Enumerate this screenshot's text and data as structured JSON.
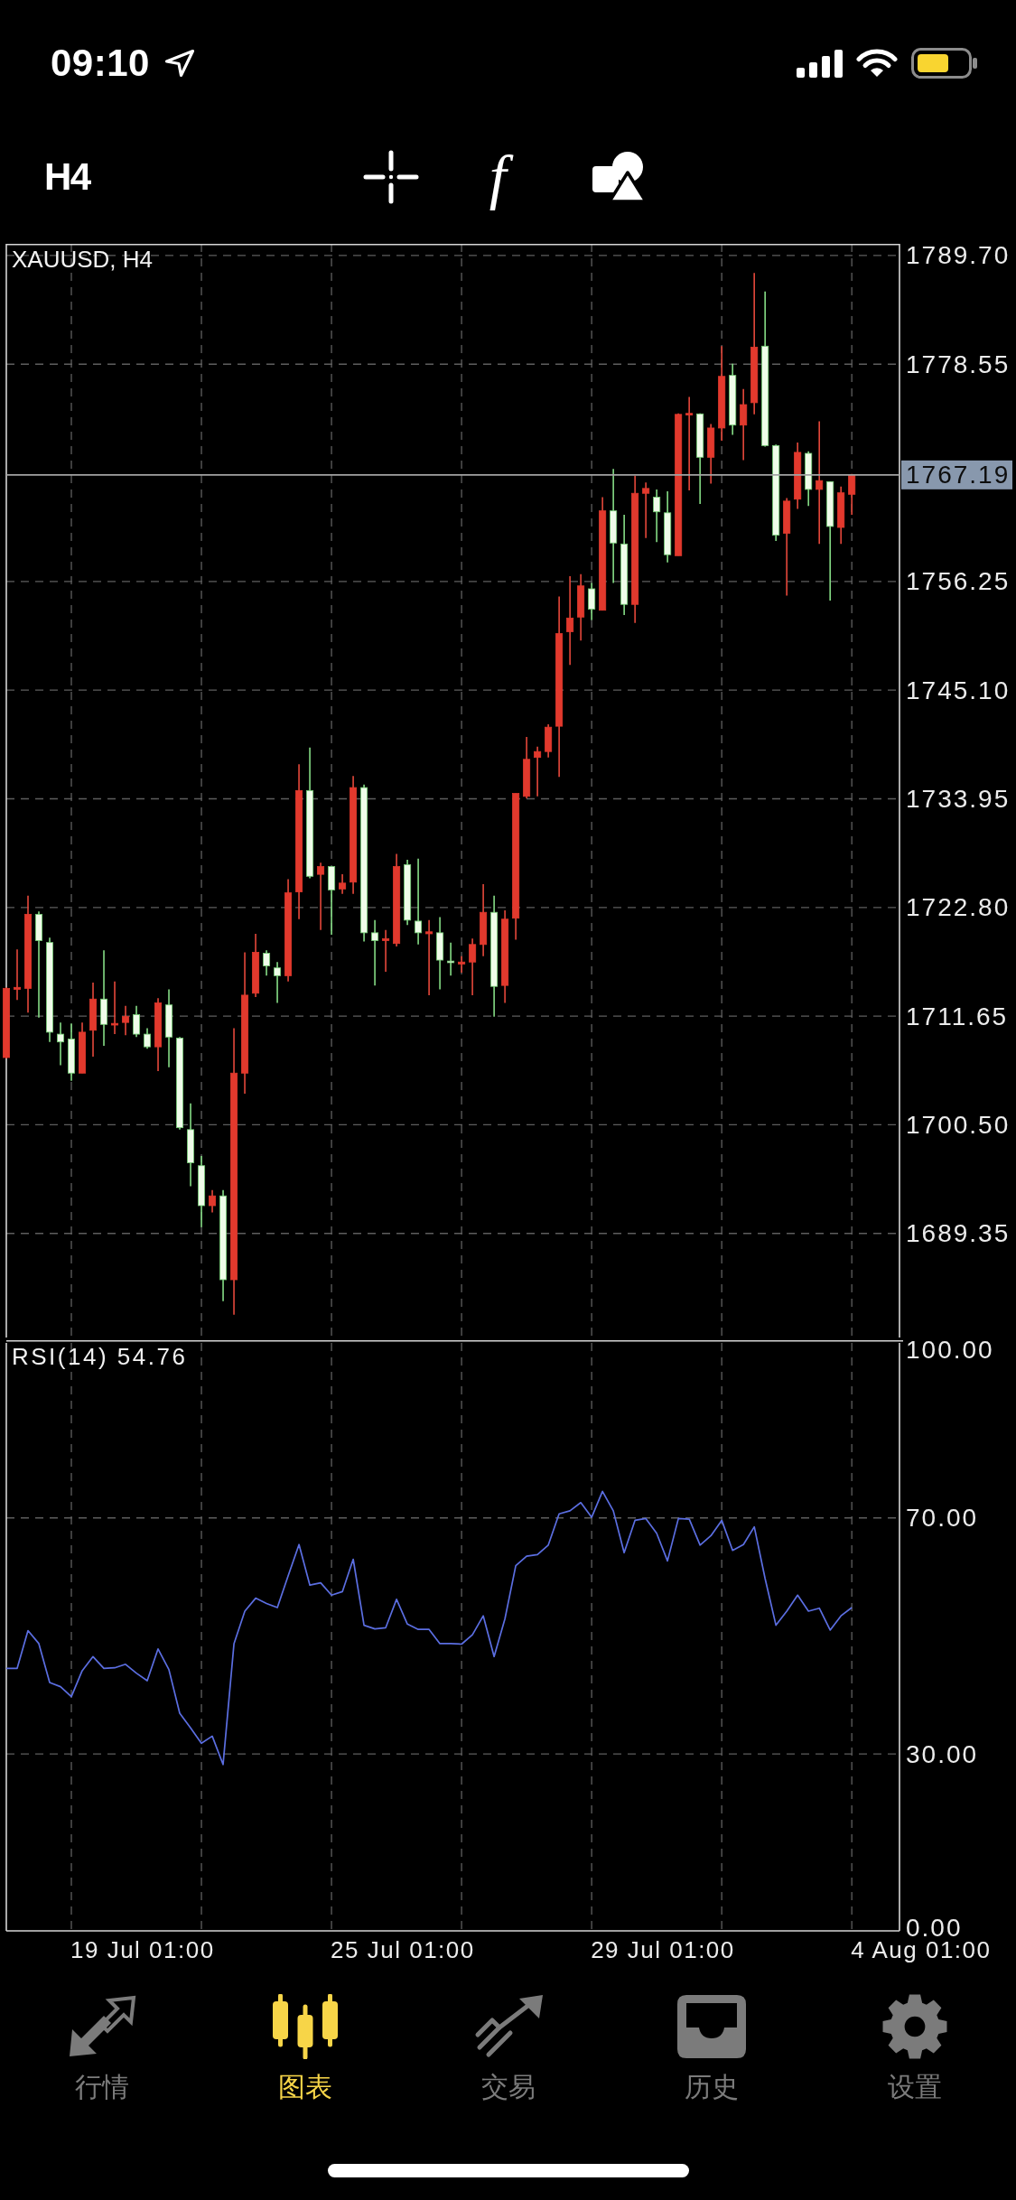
{
  "status_bar": {
    "time": "09:10"
  },
  "toolbar": {
    "timeframe": "H4",
    "tools": [
      {
        "kind": "crosshair"
      },
      {
        "kind": "function",
        "label": "f"
      },
      {
        "kind": "objects"
      }
    ]
  },
  "price_chart": {
    "chart_data": {
      "type": "candlestick",
      "title": "XAUUSD, H4",
      "categories": [
        null,
        null,
        null,
        null,
        null,
        null,
        null,
        null,
        null,
        null,
        null,
        null,
        null,
        null,
        null,
        null,
        null,
        null,
        null,
        null,
        null,
        null,
        null,
        null,
        null,
        null,
        null,
        null,
        null,
        null,
        null,
        null,
        null,
        null,
        null,
        null,
        null,
        null,
        null,
        null,
        null,
        null,
        null,
        null,
        null,
        null,
        null,
        null,
        null,
        null,
        null,
        null,
        null,
        null,
        null,
        null,
        null,
        null,
        null,
        null,
        null,
        null,
        null,
        null,
        null,
        null,
        null,
        null,
        null,
        null,
        null,
        null,
        null,
        null,
        null,
        null,
        null,
        null,
        null
      ],
      "ohlc": [
        [
          1707.4,
          1714.6,
          1707.3,
          1714.5
        ],
        [
          1714.4,
          1718.5,
          1713.3,
          1714.6
        ],
        [
          1714.5,
          1724.0,
          1712.0,
          1722.1
        ],
        [
          1722.1,
          1722.4,
          1711.5,
          1719.4
        ],
        [
          1719.2,
          1719.7,
          1709.0,
          1710.0
        ],
        [
          1709.8,
          1711.0,
          1706.6,
          1709.0
        ],
        [
          1709.3,
          1710.9,
          1705.0,
          1705.8
        ],
        [
          1705.8,
          1711.0,
          1705.8,
          1710.0
        ],
        [
          1710.2,
          1715.1,
          1707.5,
          1713.4
        ],
        [
          1713.4,
          1718.4,
          1708.6,
          1710.8
        ],
        [
          1710.8,
          1715.2,
          1709.8,
          1710.9
        ],
        [
          1711.0,
          1712.7,
          1709.7,
          1711.6
        ],
        [
          1711.8,
          1712.7,
          1709.5,
          1709.8
        ],
        [
          1709.8,
          1710.4,
          1708.3,
          1708.5
        ],
        [
          1708.5,
          1713.5,
          1706.0,
          1713.0
        ],
        [
          1712.8,
          1714.4,
          1706.4,
          1709.5
        ],
        [
          1709.4,
          1709.5,
          1700.0,
          1700.2
        ],
        [
          1700.0,
          1702.7,
          1694.2,
          1696.6
        ],
        [
          1696.3,
          1697.3,
          1690.0,
          1692.2
        ],
        [
          1692.2,
          1693.8,
          1691.5,
          1693.2
        ],
        [
          1693.2,
          1693.8,
          1682.4,
          1684.6
        ],
        [
          1684.6,
          1710.4,
          1681.0,
          1705.8
        ],
        [
          1705.8,
          1718.2,
          1703.7,
          1713.8
        ],
        [
          1714.0,
          1720.1,
          1713.6,
          1718.2
        ],
        [
          1718.1,
          1718.4,
          1715.8,
          1716.8
        ],
        [
          1716.6,
          1717.2,
          1713.0,
          1715.8
        ],
        [
          1715.8,
          1725.7,
          1715.2,
          1724.3
        ],
        [
          1724.4,
          1737.5,
          1721.6,
          1734.8
        ],
        [
          1734.8,
          1739.2,
          1725.8,
          1726.0
        ],
        [
          1726.2,
          1727.4,
          1720.5,
          1727.0
        ],
        [
          1727.0,
          1727.0,
          1720.0,
          1724.6
        ],
        [
          1724.7,
          1726.2,
          1724.2,
          1725.3
        ],
        [
          1725.4,
          1736.3,
          1724.2,
          1735.1
        ],
        [
          1735.1,
          1735.4,
          1719.3,
          1720.2
        ],
        [
          1720.2,
          1721.5,
          1714.8,
          1719.4
        ],
        [
          1719.4,
          1720.5,
          1716.2,
          1719.6
        ],
        [
          1719.1,
          1728.3,
          1718.8,
          1727.0
        ],
        [
          1727.2,
          1727.7,
          1721.0,
          1721.5
        ],
        [
          1721.4,
          1727.8,
          1719.0,
          1720.2
        ],
        [
          1720.1,
          1721.5,
          1713.8,
          1720.3
        ],
        [
          1720.2,
          1721.8,
          1714.4,
          1717.4
        ],
        [
          1717.3,
          1719.2,
          1715.8,
          1717.2
        ],
        [
          1717.0,
          1717.8,
          1716.1,
          1717.2
        ],
        [
          1717.2,
          1719.6,
          1713.8,
          1719.0
        ],
        [
          1719.0,
          1725.2,
          1717.8,
          1722.3
        ],
        [
          1722.3,
          1724.0,
          1711.6,
          1714.7
        ],
        [
          1714.8,
          1722.5,
          1713.0,
          1721.6
        ],
        [
          1721.7,
          1734.5,
          1719.5,
          1734.5
        ],
        [
          1734.2,
          1740.3,
          1734.0,
          1738.0
        ],
        [
          1738.2,
          1739.3,
          1734.2,
          1738.8
        ],
        [
          1738.8,
          1741.6,
          1738.2,
          1741.3
        ],
        [
          1741.4,
          1754.7,
          1736.2,
          1750.9
        ],
        [
          1751.1,
          1756.8,
          1747.7,
          1752.5
        ],
        [
          1752.6,
          1757.0,
          1750.2,
          1755.8
        ],
        [
          1755.5,
          1756.1,
          1752.3,
          1753.4
        ],
        [
          1753.3,
          1764.9,
          1753.3,
          1763.5
        ],
        [
          1763.5,
          1767.8,
          1756.1,
          1760.2
        ],
        [
          1760.1,
          1763.1,
          1752.8,
          1753.9
        ],
        [
          1753.9,
          1767.1,
          1752.0,
          1765.3
        ],
        [
          1765.3,
          1766.4,
          1760.7,
          1765.8
        ],
        [
          1764.9,
          1765.7,
          1760.3,
          1763.4
        ],
        [
          1763.3,
          1765.5,
          1758.2,
          1759.0
        ],
        [
          1758.9,
          1773.5,
          1758.9,
          1773.4
        ],
        [
          1773.4,
          1775.2,
          1765.6,
          1773.5
        ],
        [
          1773.45,
          1773.5,
          1764.2,
          1769.0
        ],
        [
          1769.0,
          1772.4,
          1766.3,
          1772.0
        ],
        [
          1772.0,
          1780.4,
          1770.7,
          1777.3
        ],
        [
          1777.4,
          1778.6,
          1771.3,
          1772.3
        ],
        [
          1772.3,
          1776.0,
          1768.7,
          1774.4
        ],
        [
          1774.6,
          1787.9,
          1773.4,
          1780.3
        ],
        [
          1780.4,
          1786.0,
          1770.1,
          1770.2
        ],
        [
          1770.2,
          1770.3,
          1760.4,
          1761.0
        ],
        [
          1761.2,
          1764.8,
          1754.8,
          1764.5
        ],
        [
          1764.7,
          1770.5,
          1763.7,
          1769.5
        ],
        [
          1769.4,
          1769.6,
          1764.0,
          1765.7
        ],
        [
          1765.7,
          1772.7,
          1760.1,
          1766.6
        ],
        [
          1766.5,
          1766.5,
          1754.3,
          1761.9
        ],
        [
          1761.8,
          1766.0,
          1760.1,
          1765.35
        ],
        [
          1765.2,
          1767.3,
          1763.1,
          1767.19
        ]
      ],
      "ylim": [
        1678.39,
        1790.9
      ],
      "yticks": [
        {
          "value": 1789.7,
          "label": "1789.70"
        },
        {
          "value": 1778.55,
          "label": "1778.55"
        },
        {
          "value": 1756.25,
          "label": "1756.25"
        },
        {
          "value": 1745.1,
          "label": "1745.10"
        },
        {
          "value": 1733.95,
          "label": "1733.95"
        },
        {
          "value": 1722.8,
          "label": "1722.80"
        },
        {
          "value": 1711.65,
          "label": "1711.65"
        },
        {
          "value": 1700.5,
          "label": "1700.50"
        },
        {
          "value": 1689.35,
          "label": "1689.35"
        }
      ],
      "grid": true,
      "ref_lines": [
        {
          "axis": "y",
          "value": 1767.19,
          "label": "1767.19",
          "color": "#a3a3a3"
        }
      ]
    }
  },
  "rsi_chart": {
    "chart_data": {
      "type": "line",
      "title": "RSI(14) 54.76",
      "categories": [
        null,
        null,
        null,
        null,
        null,
        null,
        null,
        null,
        null,
        null,
        null,
        null,
        null,
        null,
        null,
        null,
        null,
        null,
        null,
        null,
        null,
        null,
        null,
        null,
        null,
        null,
        null,
        null,
        null,
        null,
        null,
        null,
        null,
        null,
        null,
        null,
        null,
        null,
        null,
        null,
        null,
        null,
        null,
        null,
        null,
        null,
        null,
        null,
        null,
        null,
        null,
        null,
        null,
        null,
        null,
        null,
        null,
        null,
        null,
        null,
        null,
        null,
        null,
        null,
        null,
        null,
        null,
        null,
        null,
        null,
        null,
        null,
        null,
        null,
        null,
        null,
        null,
        null,
        null
      ],
      "ylim": [
        0,
        100
      ],
      "yticks": [
        {
          "value": 100,
          "label": "100.00"
        },
        {
          "value": 70,
          "label": "70.00"
        },
        {
          "value": 30,
          "label": "30.00"
        },
        {
          "value": 0,
          "label": "0.00"
        }
      ],
      "grid": true,
      "series": [
        {
          "color": "#5b6ee1",
          "values": [
            44.5,
            44.5,
            50.9,
            48.7,
            42.1,
            41.4,
            39.7,
            44.1,
            46.5,
            44.5,
            44.6,
            45.2,
            43.7,
            42.4,
            47.8,
            44.3,
            36.9,
            34.4,
            31.8,
            33.0,
            28.2,
            48.7,
            54.2,
            56.4,
            55.5,
            54.8,
            60.2,
            65.5,
            58.6,
            59.0,
            56.9,
            57.5,
            63.0,
            51.8,
            51.2,
            51.4,
            56.2,
            52.0,
            51.1,
            51.1,
            48.7,
            48.7,
            48.6,
            50.2,
            53.4,
            46.5,
            52.9,
            61.9,
            63.5,
            63.8,
            65.4,
            70.7,
            71.2,
            72.6,
            70.1,
            74.5,
            71.2,
            64.1,
            69.6,
            69.9,
            67.4,
            62.7,
            69.9,
            69.8,
            65.4,
            67.0,
            69.6,
            64.5,
            65.5,
            68.5,
            59.7,
            51.8,
            54.2,
            56.9,
            54.2,
            54.7,
            51.0,
            53.4,
            54.8
          ]
        }
      ]
    }
  },
  "time_axis": {
    "labels": [
      "19 Jul 01:00",
      "25 Jul 01:00",
      "29 Jul 01:00",
      "4 Aug 01:00"
    ]
  },
  "tabs": [
    {
      "kind": "quotes",
      "label": "行情",
      "selected": false
    },
    {
      "kind": "chart",
      "label": "图表",
      "selected": true
    },
    {
      "kind": "trade",
      "label": "交易",
      "selected": false
    },
    {
      "kind": "history",
      "label": "历史",
      "selected": false
    },
    {
      "kind": "settings",
      "label": "设置",
      "selected": false
    }
  ]
}
